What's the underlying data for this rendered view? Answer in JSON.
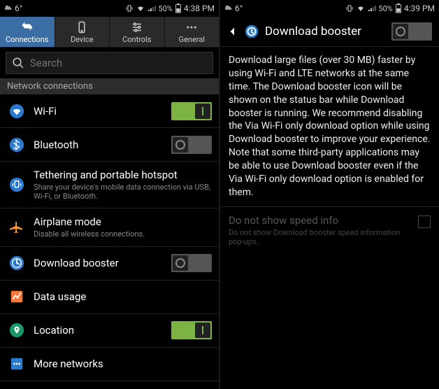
{
  "left": {
    "status": {
      "temp": "6°",
      "battery": "50%",
      "time": "4:38 PM"
    },
    "tabs": [
      {
        "label": "Connections",
        "active": true
      },
      {
        "label": "Device",
        "active": false
      },
      {
        "label": "Controls",
        "active": false
      },
      {
        "label": "General",
        "active": false
      }
    ],
    "search_placeholder": "Search",
    "section": "Network connections",
    "rows": [
      {
        "icon": "wifi",
        "title": "Wi-Fi",
        "sub": "",
        "toggle": "on"
      },
      {
        "icon": "bluetooth",
        "title": "Bluetooth",
        "sub": "",
        "toggle": "off"
      },
      {
        "icon": "tether",
        "title": "Tethering and portable hotspot",
        "sub": "Share your device's mobile data connection via USB, Wi-Fi, or Bluetooth.",
        "toggle": null
      },
      {
        "icon": "airplane",
        "title": "Airplane mode",
        "sub": "Disable all wireless connections.",
        "toggle": null
      },
      {
        "icon": "booster",
        "title": "Download booster",
        "sub": "",
        "toggle": "off"
      },
      {
        "icon": "data",
        "title": "Data usage",
        "sub": "",
        "toggle": null
      },
      {
        "icon": "location",
        "title": "Location",
        "sub": "",
        "toggle": "on"
      },
      {
        "icon": "more",
        "title": "More networks",
        "sub": "",
        "toggle": null
      }
    ]
  },
  "right": {
    "status": {
      "temp": "6°",
      "battery": "50%",
      "time": "4:39 PM"
    },
    "title": "Download booster",
    "toggle": "off",
    "description": "Download large files (over 30 MB) faster by using Wi-Fi and LTE networks at the same time. The Download booster icon will be shown on the status bar while Download booster is running. We recommend disabling the Via Wi-Fi only download option while using Download booster to improve your experience. Note that some third-party applications may be able to use Download booster even if the Via Wi-Fi only download option is enabled for them.",
    "checkbox": {
      "title": "Do not show speed info",
      "sub": "Do not show Download booster speed information pop-ups.",
      "enabled": false,
      "checked": false
    }
  }
}
